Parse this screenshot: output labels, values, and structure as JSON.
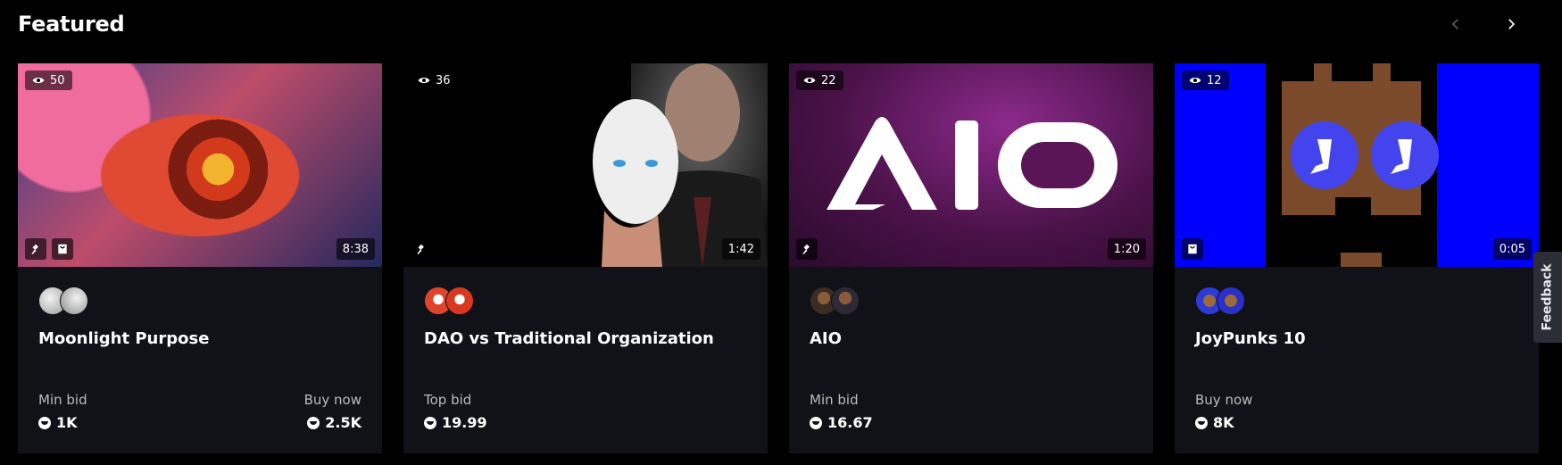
{
  "header": {
    "title": "Featured"
  },
  "cards": [
    {
      "views": "50",
      "duration": "8:38",
      "title": "Moonlight Purpose",
      "prices": [
        {
          "label": "Min bid",
          "value": "1K"
        },
        {
          "label": "Buy now",
          "value": "2.5K"
        }
      ]
    },
    {
      "views": "36",
      "duration": "1:42",
      "title": "DAO vs Traditional Organization",
      "prices": [
        {
          "label": "Top bid",
          "value": "19.99"
        }
      ]
    },
    {
      "views": "22",
      "duration": "1:20",
      "title": "AIO",
      "art_text": "AIO",
      "prices": [
        {
          "label": "Min bid",
          "value": "16.67"
        }
      ]
    },
    {
      "views": "12",
      "duration": "0:05",
      "title": "JoyPunks 10",
      "prices": [
        {
          "label": "Buy now",
          "value": "8K"
        }
      ]
    }
  ],
  "feedback_label": "Feedback",
  "colors": {
    "background": "#000000",
    "card": "#111217",
    "muted_text": "#bbbbbb",
    "feedback_tab": "#2b2e36",
    "joy_blue": "#0000ff",
    "joy_token": "#4040e0"
  }
}
